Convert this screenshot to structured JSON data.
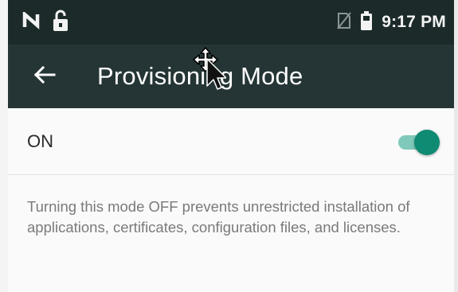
{
  "status_bar": {
    "time": "9:17 PM",
    "left_icons": [
      "notification-n-icon",
      "lock-open-icon"
    ],
    "right_icons": [
      "no-sim-icon",
      "battery-icon"
    ]
  },
  "toolbar": {
    "title": "Provisioning Mode",
    "back_icon": "arrow-left-icon",
    "background": "#253535"
  },
  "setting": {
    "label": "ON",
    "enabled": true,
    "accent": "#0f8a73"
  },
  "description": "Turning this mode OFF prevents unrestricted installation of applications, certificates, configuration files, and licenses.",
  "cursor": {
    "icon": "move-cursor-icon"
  }
}
